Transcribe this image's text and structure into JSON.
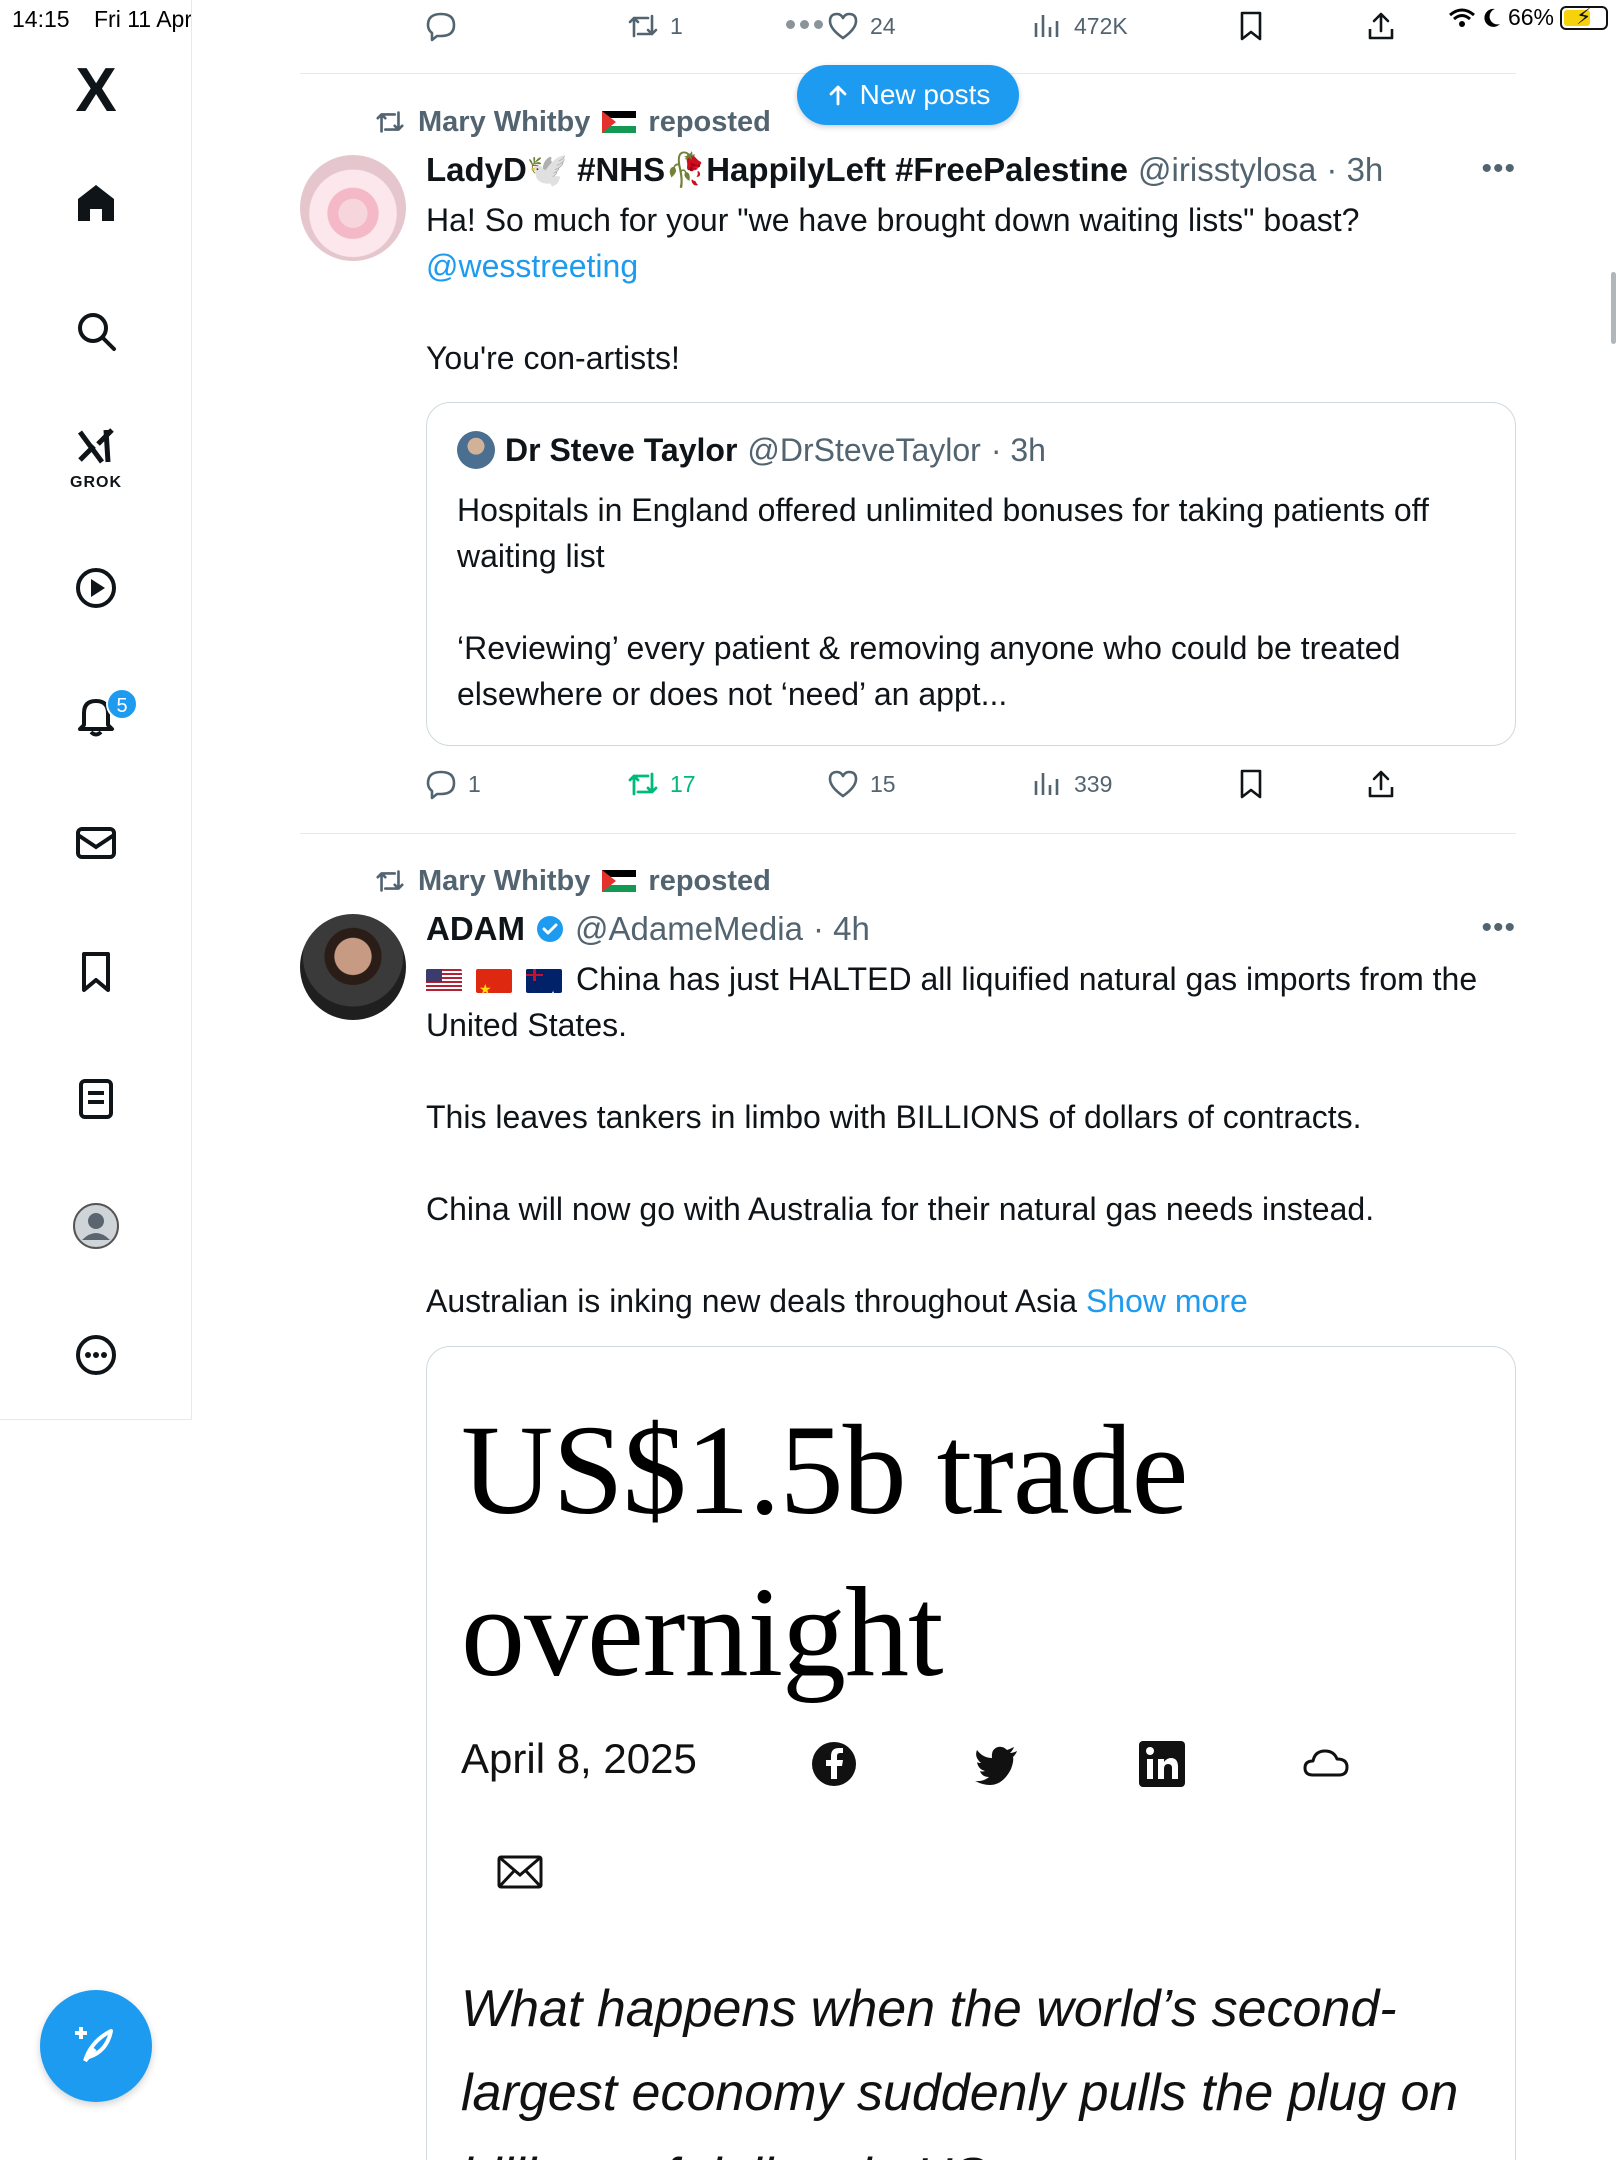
{
  "status_bar": {
    "time": "14:15",
    "date": "Fri 11 Apr",
    "battery": "66%",
    "battery_level": 0.66
  },
  "sidebar": {
    "logo": "X",
    "grok_label": "GROK",
    "notifications_count": "5",
    "icons": [
      "home-icon",
      "search-icon",
      "grok-icon",
      "video-icon",
      "bell-icon",
      "mail-icon",
      "bookmark-icon",
      "lists-icon",
      "profile-icon",
      "more-icon"
    ]
  },
  "top_actions": {
    "replies": "",
    "reposts": "1",
    "likes": "24",
    "views": "472K"
  },
  "new_posts_label": "New posts",
  "post1": {
    "repost_by": "Mary Whitby",
    "repost_suffix": "reposted",
    "display_name": "LadyD🕊️ #NHS🥀HappilyLeft #FreePalestine",
    "handle": "@irisstylosa",
    "time": "· 3h",
    "text_line1": "Ha! So much for your \"we have brought down waiting lists\" boast?",
    "mention": "@wesstreeting",
    "text_line3": "You're con-artists!",
    "quote": {
      "display_name": "Dr Steve Taylor",
      "handle": "@DrSteveTaylor",
      "time": "· 3h",
      "para1": "Hospitals in England offered unlimited bonuses for taking patients off waiting list",
      "para2": "‘Reviewing’ every patient & removing anyone who could be treated elsewhere or does not ‘need’ an appt..."
    },
    "actions": {
      "replies": "1",
      "reposts": "17",
      "likes": "15",
      "views": "339"
    }
  },
  "post2": {
    "repost_by": "Mary Whitby",
    "repost_suffix": "reposted",
    "display_name": "ADAM",
    "handle": "@AdameMedia",
    "time": "· 4h",
    "para1": "China has just HALTED all liquified natural gas imports from the United States.",
    "para2": "This leaves tankers in limbo with BILLIONS of dollars of contracts.",
    "para3": "China will now go with Australia for their natural gas needs instead.",
    "para4": "Australian is inking new deals throughout Asia",
    "show_more": "Show more",
    "media": {
      "headline": "US$1.5b trade overnight",
      "date": "April 8, 2025",
      "lede": "What happens when the world’s second-largest economy suddenly pulls the plug on billions of dollars in US"
    }
  },
  "colors": {
    "accent": "#1d9bf0",
    "repost_green": "#00ba7c",
    "muted_text": "#536471"
  }
}
